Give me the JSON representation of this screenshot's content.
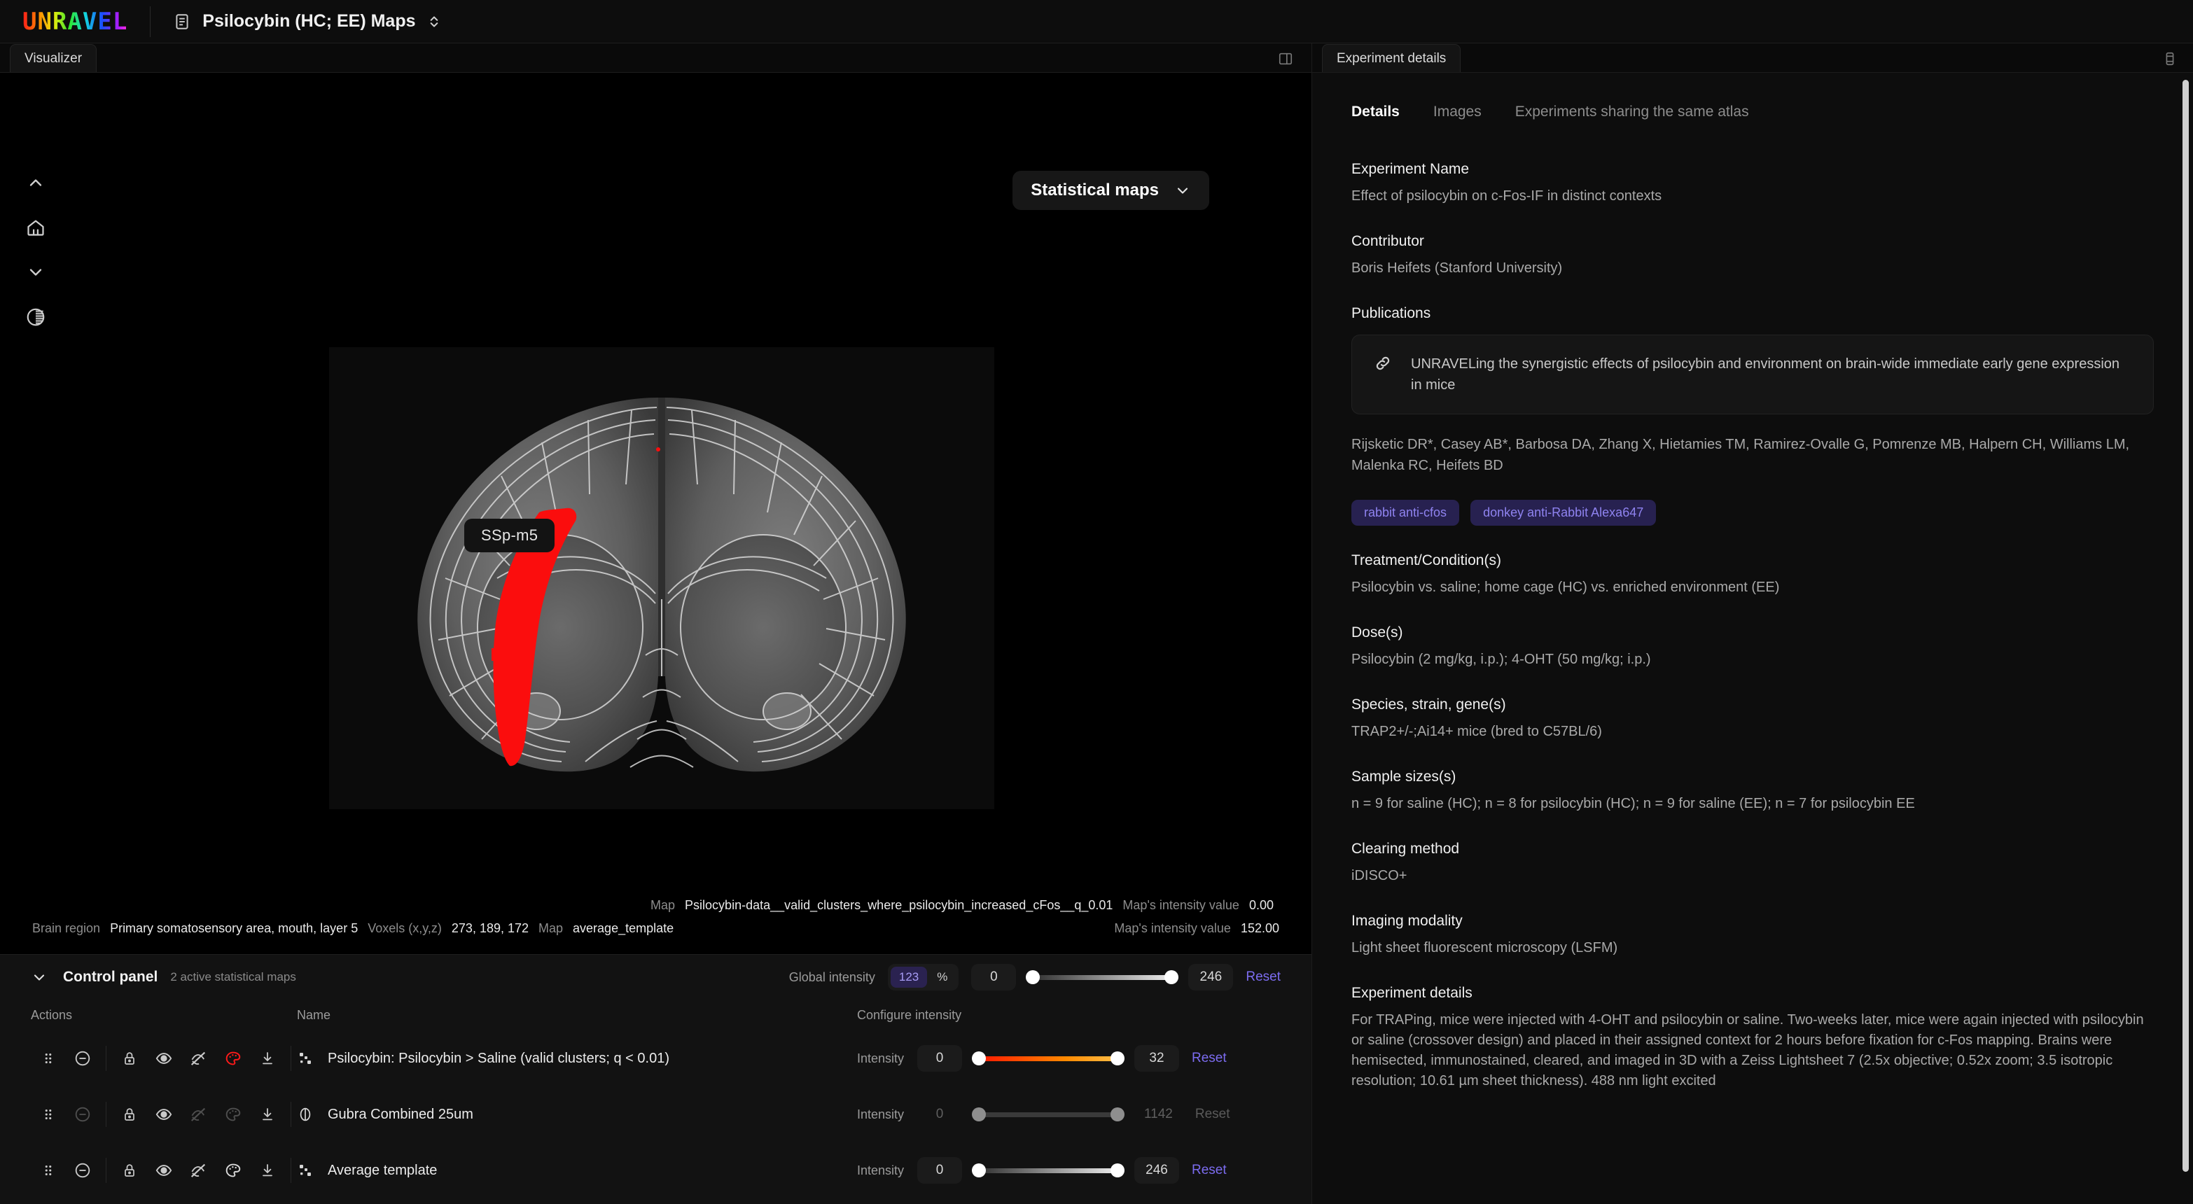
{
  "app": {
    "logo_text": "UNRAVEL",
    "document_icon": "document-icon",
    "document_title": "Psilocybin (HC; EE) Maps",
    "title_chevrons_icon": "chevron-up-down-icon"
  },
  "visualizer": {
    "tab_label": "Visualizer",
    "panel_icon": "panel-layout-icon",
    "toolbar": [
      {
        "name": "chevron-up-icon",
        "label": "Move up"
      },
      {
        "name": "home-icon",
        "label": "Reset view"
      },
      {
        "name": "chevron-down-icon",
        "label": "Move down"
      },
      {
        "name": "contrast-icon",
        "label": "Contrast"
      }
    ],
    "maps_dropdown": {
      "label": "Statistical maps",
      "chevron_icon": "chevron-down-icon"
    },
    "region_tooltip": "SSp-m5",
    "info": {
      "map_label_top": "Map",
      "map_value_top": "Psilocybin-data__valid_clusters_where_psilocybin_increased_cFos__q_0.01",
      "intensity_label_top": "Map's intensity value",
      "intensity_value_top": "0.00",
      "brain_region_label": "Brain region",
      "brain_region_value": "Primary somatosensory area, mouth, layer 5",
      "voxels_label": "Voxels (x,y,z)",
      "voxels_value": "273, 189, 172",
      "map_label_bottom": "Map",
      "map_value_bottom": "average_template",
      "intensity_label_bottom": "Map's intensity value",
      "intensity_value_bottom": "152.00"
    }
  },
  "control_panel": {
    "caret_icon": "chevron-down-icon",
    "title": "Control panel",
    "subtitle": "2 active statistical maps",
    "global_intensity": {
      "label": "Global intensity",
      "mode_numeric": "123",
      "mode_percent": "%",
      "active_mode": "123",
      "min": "0",
      "max": "246",
      "reset": "Reset"
    },
    "columns": {
      "actions": "Actions",
      "name": "Name",
      "intensity": "Configure intensity"
    },
    "rows": [
      {
        "icons": [
          "drag-handle-icon",
          "minus-circle-icon",
          "lock-icon",
          "eye-icon",
          "eye-off-icon",
          "palette-icon",
          "download-icon"
        ],
        "palette_color": "#ff1a1a",
        "type_icon": "cluster-dots-icon",
        "name": "Psilocybin: Psilocybin > Saline (valid clusters; q < 0.01)",
        "intensity_label": "Intensity",
        "min": "0",
        "max": "32",
        "reset": "Reset",
        "track": "red",
        "disabled": false
      },
      {
        "icons": [
          "drag-handle-icon",
          "minus-circle-icon",
          "lock-icon",
          "eye-icon",
          "eye-off-icon",
          "palette-icon",
          "download-icon"
        ],
        "palette_color": "#6a6a6a",
        "type_icon": "brain-outline-icon",
        "name": "Gubra Combined 25um",
        "intensity_label": "Intensity",
        "min": "0",
        "max": "1142",
        "reset": "Reset",
        "track": "flat",
        "disabled": true
      },
      {
        "icons": [
          "drag-handle-icon",
          "minus-circle-icon",
          "lock-icon",
          "eye-icon",
          "eye-off-icon",
          "palette-icon",
          "download-icon"
        ],
        "palette_color": "#d8d8d8",
        "type_icon": "cluster-dots-icon",
        "name": "Average template",
        "intensity_label": "Intensity",
        "min": "0",
        "max": "246",
        "reset": "Reset",
        "track": "gray",
        "disabled": false
      }
    ]
  },
  "details": {
    "tab_label": "Experiment details",
    "panel_icon": "panel-layout-icon",
    "subtabs": [
      {
        "label": "Details",
        "active": true
      },
      {
        "label": "Images",
        "active": false
      },
      {
        "label": "Experiments sharing the same atlas",
        "active": false
      }
    ],
    "experiment_name_label": "Experiment Name",
    "experiment_name_value": "Effect of psilocybin on c-Fos-IF in distinct contexts",
    "contributor_label": "Contributor",
    "contributor_value": "Boris Heifets (Stanford University)",
    "publications_label": "Publications",
    "publication_icon": "link-icon",
    "publication_title": "UNRAVELing the synergistic effects of psilocybin and environment on brain-wide immediate early gene expression in mice",
    "authors": "Rijsketic DR*, Casey AB*, Barbosa DA, Zhang X, Hietamies TM, Ramirez-Ovalle G, Pomrenze MB, Halpern CH, Williams LM, Malenka RC, Heifets BD",
    "tags": [
      "rabbit anti-cfos",
      "donkey anti-Rabbit Alexa647"
    ],
    "treatment_label": "Treatment/Condition(s)",
    "treatment_value": "Psilocybin vs. saline; home cage (HC) vs. enriched environment (EE)",
    "dose_label": "Dose(s)",
    "dose_value": "Psilocybin (2 mg/kg, i.p.); 4-OHT (50 mg/kg; i.p.)",
    "species_label": "Species, strain, gene(s)",
    "species_value": "TRAP2+/-;Ai14+ mice (bred to C57BL/6)",
    "sample_label": "Sample sizes(s)",
    "sample_value": "n = 9 for saline (HC); n = 8 for psilocybin (HC); n = 9 for saline (EE); n = 7 for psilocybin EE",
    "clearing_label": "Clearing method",
    "clearing_value": "iDISCO+",
    "imaging_label": "Imaging modality",
    "imaging_value": "Light sheet fluorescent microscopy (LSFM)",
    "details_label": "Experiment details",
    "details_value": "For TRAPing, mice were injected with 4-OHT and psilocybin or saline. Two-weeks later, mice were again injected with psilocybin or saline (crossover design) and placed in their assigned context for 2 hours before fixation for c-Fos mapping. Brains were hemisected, immunostained, cleared, and imaged in 3D with a Zeiss Lightsheet 7 (2.5x objective; 0.52x zoom; 3.5 isotropic resolution; 10.61 µm sheet thickness). 488 nm light excited"
  },
  "colors": {
    "accent": "#7c6cf0",
    "cluster": "#ff1a1a",
    "tag_bg": "#272150",
    "tag_fg": "#8f83f0"
  }
}
